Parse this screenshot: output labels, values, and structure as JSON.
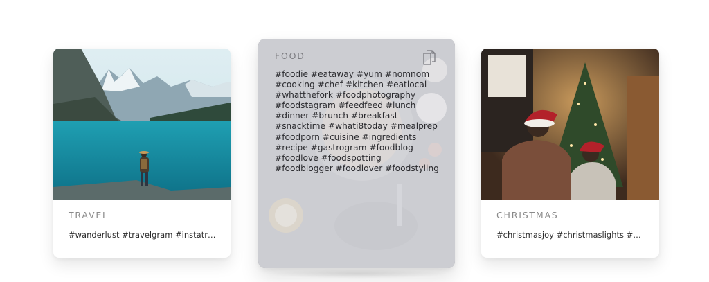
{
  "cards": [
    {
      "category": "TRAVEL",
      "hashtags": "#wanderlust #travelgram #instatravel #travelphotography #traveling"
    },
    {
      "category": "FOOD",
      "hashtag_lines": [
        "#foodie #eataway #yum #nomnom",
        "#cooking #chef #kitchen #eatlocal",
        "#whatthefork #foodphotography",
        "#foodstagram #feedfeed #lunch",
        "#dinner #brunch #breakfast",
        "#snacktime #whati8today #mealprep",
        "#foodporn #cuisine #ingredients",
        "#recipe #gastrogram #foodblog",
        "#foodlove #foodspotting",
        "#foodblogger #foodlover #foodstyling"
      ],
      "action_icon": "copy-icon"
    },
    {
      "category": "CHRISTMAS",
      "hashtags": "#christmasjoy #christmaslights #christmastime #merrychristmas"
    }
  ]
}
